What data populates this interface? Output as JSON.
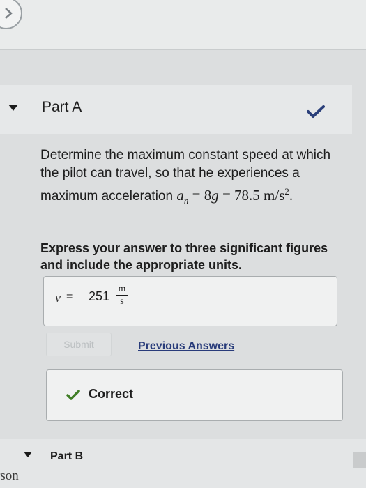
{
  "part_a": {
    "title": "Part A",
    "question_intro": "Determine the maximum constant speed at which the pilot can travel, so that he experiences a maximum acceleration",
    "question_math": "a_n = 8g = 78.5 m/s².",
    "instruction": "Express your answer to three significant figures and include the appropriate units.",
    "answer": {
      "variable": "v",
      "equals": "=",
      "value": "251",
      "unit_numerator": "m",
      "unit_denominator": "s"
    },
    "submit_label": "Submit",
    "previous_answers_label": "Previous Answers",
    "result_label": "Correct"
  },
  "part_b": {
    "title": "Part B"
  },
  "footer": {
    "partial_text": "rson"
  },
  "colors": {
    "link": "#283b7a",
    "correct_check": "#3f7d25",
    "header_check": "#2a3f7a"
  }
}
